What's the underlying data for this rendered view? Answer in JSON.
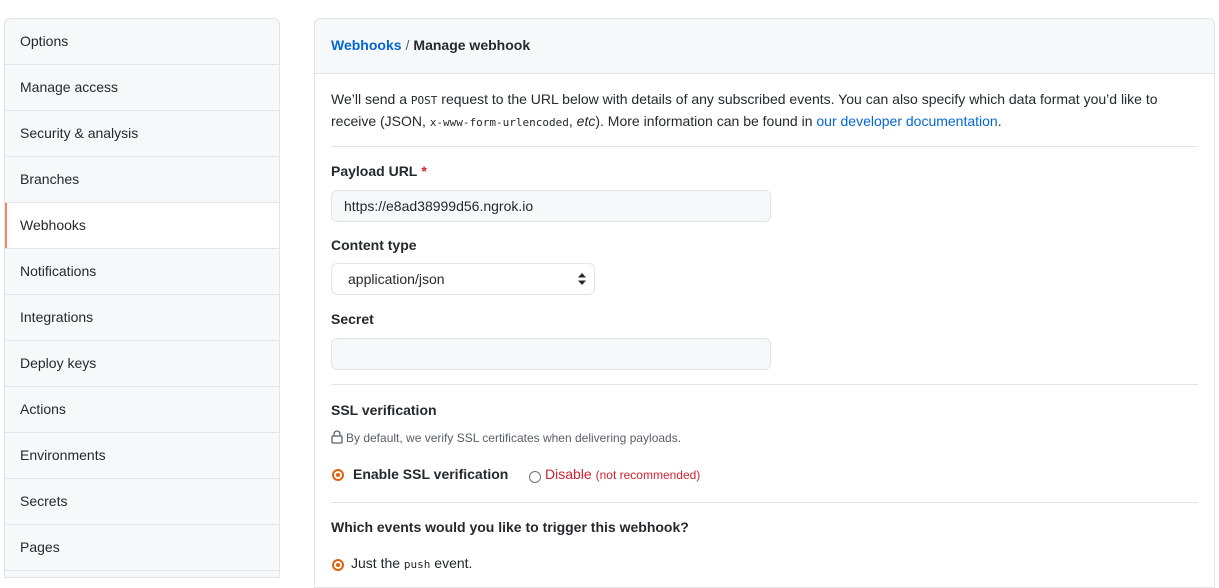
{
  "sidebar": {
    "items": [
      {
        "label": "Options"
      },
      {
        "label": "Manage access"
      },
      {
        "label": "Security & analysis"
      },
      {
        "label": "Branches"
      },
      {
        "label": "Webhooks",
        "selected": true
      },
      {
        "label": "Notifications"
      },
      {
        "label": "Integrations"
      },
      {
        "label": "Deploy keys"
      },
      {
        "label": "Actions"
      },
      {
        "label": "Environments"
      },
      {
        "label": "Secrets"
      },
      {
        "label": "Pages"
      }
    ]
  },
  "breadcrumb": {
    "link": "Webhooks",
    "separator": "/",
    "current": "Manage webhook"
  },
  "intro": {
    "p1": "We’ll send a ",
    "method": "POST",
    "p2": " request to the URL below with details of any subscribed events. You can also specify which data format you’d like to receive (JSON, ",
    "encoding": "x-www-form-urlencoded",
    "p3": ", ",
    "etc": "etc",
    "p4": "). More information can be found in ",
    "link": "our developer documentation",
    "p5": "."
  },
  "form": {
    "payload_url": {
      "label": "Payload URL",
      "required": "*",
      "value": "https://e8ad38999d56.ngrok.io"
    },
    "content_type": {
      "label": "Content type",
      "selected": "application/json"
    },
    "secret": {
      "label": "Secret",
      "value": ""
    },
    "ssl": {
      "label": "SSL verification",
      "note": "By default, we verify SSL certificates when delivering payloads.",
      "enable_label": "Enable SSL verification",
      "disable_label": "Disable",
      "disable_note": "(not recommended)",
      "selected": "enable"
    },
    "events": {
      "question": "Which events would you like to trigger this webhook?",
      "option1_pre": "Just the ",
      "option1_code": "push",
      "option1_post": " event."
    }
  },
  "colors": {
    "accent": "#f9826c",
    "link": "#0366d6",
    "danger": "#cb2431",
    "radio": "#e36209"
  }
}
